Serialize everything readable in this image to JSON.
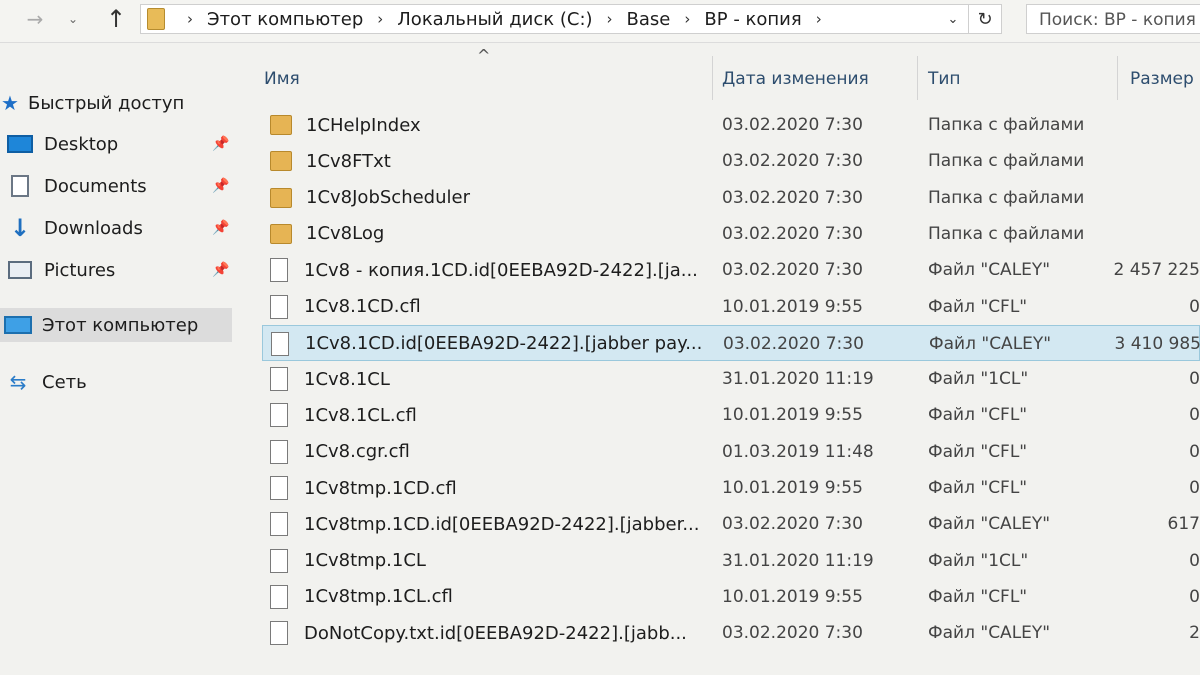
{
  "address": {
    "crumbs": [
      "Этот компьютер",
      "Локальный диск (C:)",
      "Base",
      "BP - копия"
    ]
  },
  "search": {
    "placeholder": "Поиск: BP - копия"
  },
  "sidebar": {
    "quick_access": "Быстрый доступ",
    "items": [
      {
        "label": "Desktop",
        "icon": "desktop-icon",
        "pinned": true
      },
      {
        "label": "Documents",
        "icon": "documents-icon",
        "pinned": true
      },
      {
        "label": "Downloads",
        "icon": "downloads-icon",
        "pinned": true
      },
      {
        "label": "Pictures",
        "icon": "pictures-icon",
        "pinned": true
      }
    ],
    "this_pc": "Этот компьютер",
    "network": "Сеть"
  },
  "columns": {
    "name": "Имя",
    "date": "Дата изменения",
    "type": "Тип",
    "size": "Размер"
  },
  "files": [
    {
      "name": "1CHelpIndex",
      "date": "03.02.2020 7:30",
      "type": "Папка с файлами",
      "size": "",
      "kind": "folder"
    },
    {
      "name": "1Cv8FTxt",
      "date": "03.02.2020 7:30",
      "type": "Папка с файлами",
      "size": "",
      "kind": "folder"
    },
    {
      "name": "1Cv8JobScheduler",
      "date": "03.02.2020 7:30",
      "type": "Папка с файлами",
      "size": "",
      "kind": "folder"
    },
    {
      "name": "1Cv8Log",
      "date": "03.02.2020 7:30",
      "type": "Папка с файлами",
      "size": "",
      "kind": "folder"
    },
    {
      "name": "1Cv8 - копия.1CD.id[0EEBA92D-2422].[ja...",
      "date": "03.02.2020 7:30",
      "type": "Файл \"CALEY\"",
      "size": "2 457 225",
      "kind": "file"
    },
    {
      "name": "1Cv8.1CD.cfl",
      "date": "10.01.2019 9:55",
      "type": "Файл \"CFL\"",
      "size": "0",
      "kind": "file"
    },
    {
      "name": "1Cv8.1CD.id[0EEBA92D-2422].[jabber pay...",
      "date": "03.02.2020 7:30",
      "type": "Файл \"CALEY\"",
      "size": "3 410 985",
      "kind": "file",
      "selected": true
    },
    {
      "name": "1Cv8.1CL",
      "date": "31.01.2020 11:19",
      "type": "Файл \"1CL\"",
      "size": "0",
      "kind": "file"
    },
    {
      "name": "1Cv8.1CL.cfl",
      "date": "10.01.2019 9:55",
      "type": "Файл \"CFL\"",
      "size": "0",
      "kind": "file"
    },
    {
      "name": "1Cv8.cgr.cfl",
      "date": "01.03.2019 11:48",
      "type": "Файл \"CFL\"",
      "size": "0",
      "kind": "file"
    },
    {
      "name": "1Cv8tmp.1CD.cfl",
      "date": "10.01.2019 9:55",
      "type": "Файл \"CFL\"",
      "size": "0",
      "kind": "file"
    },
    {
      "name": "1Cv8tmp.1CD.id[0EEBA92D-2422].[jabber...",
      "date": "03.02.2020 7:30",
      "type": "Файл \"CALEY\"",
      "size": "617",
      "kind": "file"
    },
    {
      "name": "1Cv8tmp.1CL",
      "date": "31.01.2020 11:19",
      "type": "Файл \"1CL\"",
      "size": "0",
      "kind": "file"
    },
    {
      "name": "1Cv8tmp.1CL.cfl",
      "date": "10.01.2019 9:55",
      "type": "Файл \"CFL\"",
      "size": "0",
      "kind": "file"
    },
    {
      "name": "DoNotCopy.txt.id[0EEBA92D-2422].[jabb...",
      "date": "03.02.2020 7:30",
      "type": "Файл \"CALEY\"",
      "size": "2",
      "kind": "file"
    }
  ]
}
